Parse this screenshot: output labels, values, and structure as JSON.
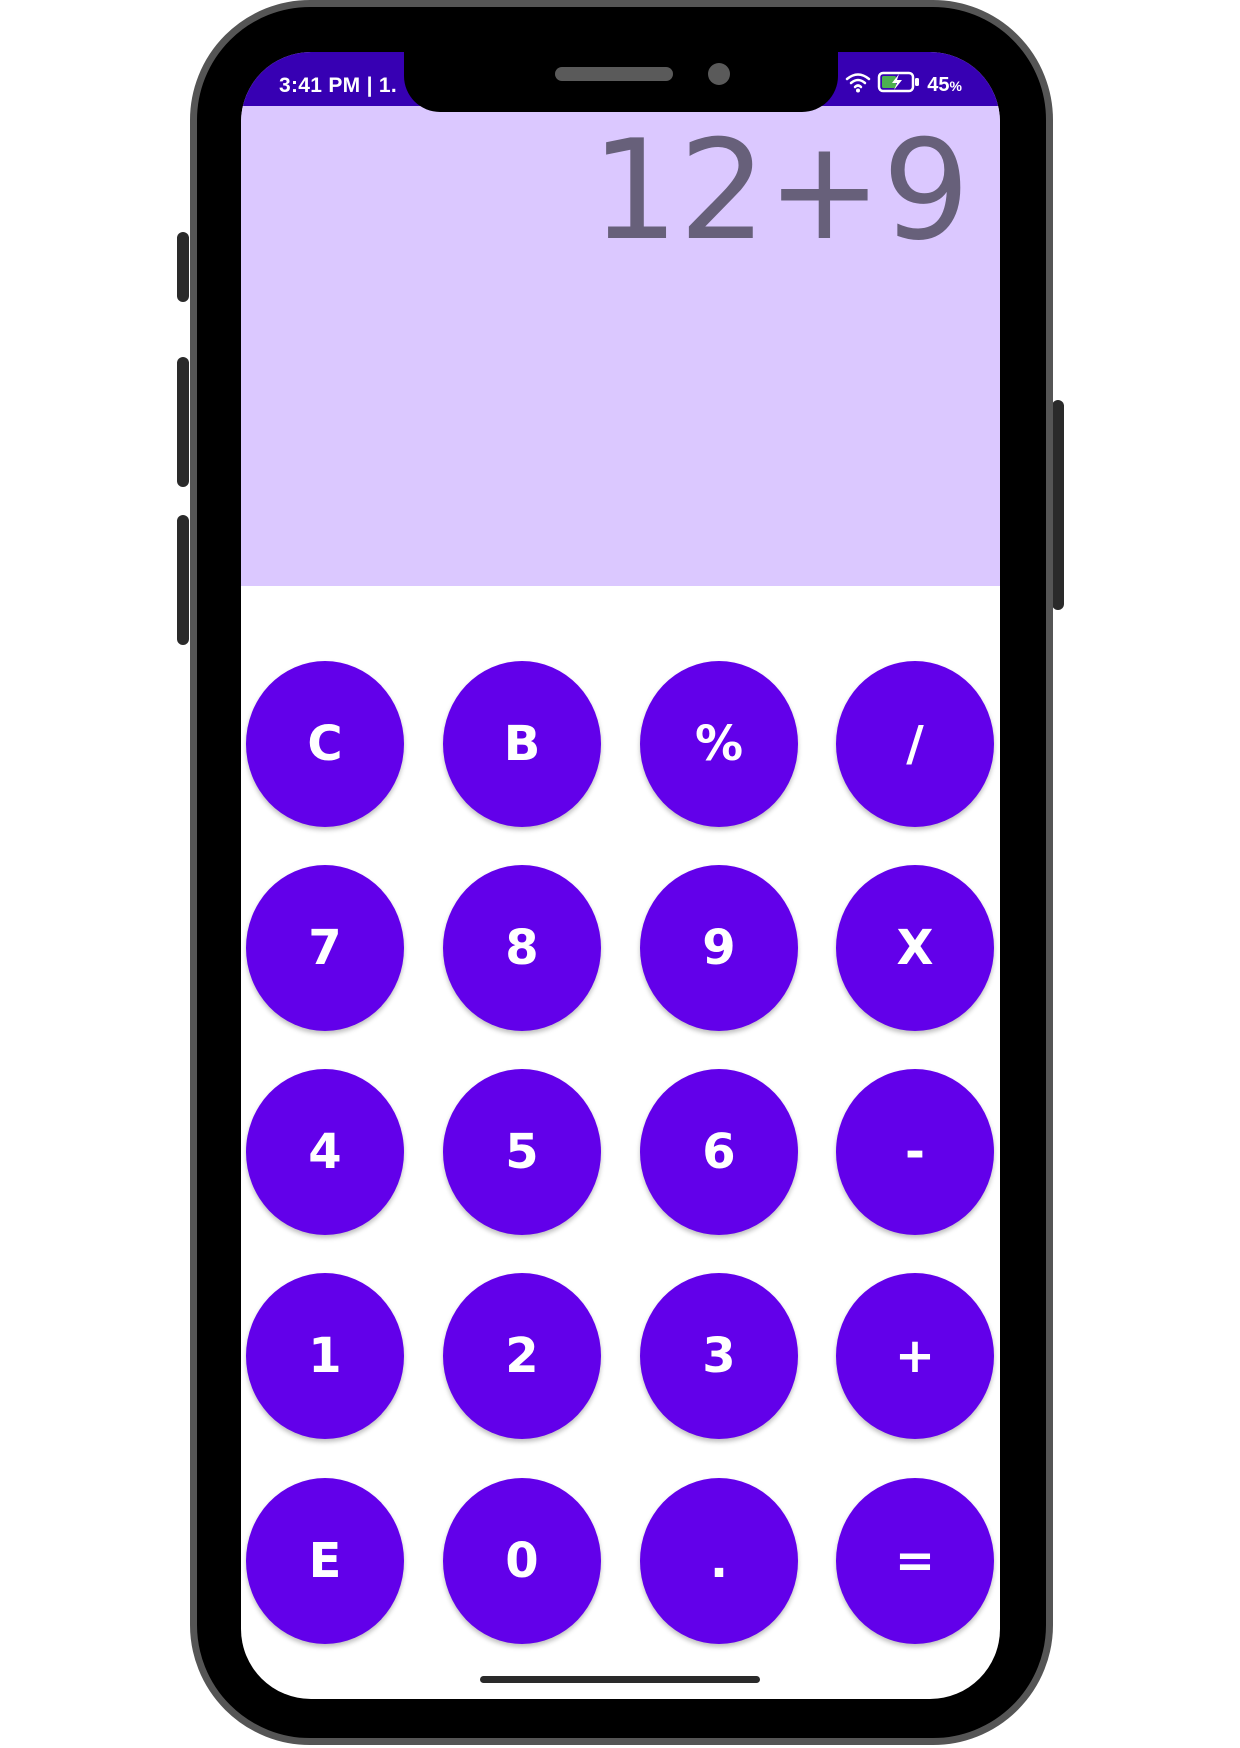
{
  "status_bar": {
    "time": "3:41 PM | 1.",
    "battery_percent": "45",
    "battery_percent_sign": "%",
    "icons": [
      "wifi-icon",
      "battery-charging-icon"
    ],
    "background": "#3700B3"
  },
  "display": {
    "expression": "12+9",
    "background": "#DBC8FF",
    "text_color": "#67607A"
  },
  "keypad": {
    "button_color": "#6200EA",
    "rows": [
      [
        {
          "label": "C"
        },
        {
          "label": "B"
        },
        {
          "label": "%"
        },
        {
          "label": "/"
        }
      ],
      [
        {
          "label": "7"
        },
        {
          "label": "8"
        },
        {
          "label": "9"
        },
        {
          "label": "X"
        }
      ],
      [
        {
          "label": "4"
        },
        {
          "label": "5"
        },
        {
          "label": "6"
        },
        {
          "label": "-"
        }
      ],
      [
        {
          "label": "1"
        },
        {
          "label": "2"
        },
        {
          "label": "3"
        },
        {
          "label": "+"
        }
      ],
      [
        {
          "label": "E"
        },
        {
          "label": "0"
        },
        {
          "label": "."
        },
        {
          "label": "="
        }
      ]
    ]
  }
}
